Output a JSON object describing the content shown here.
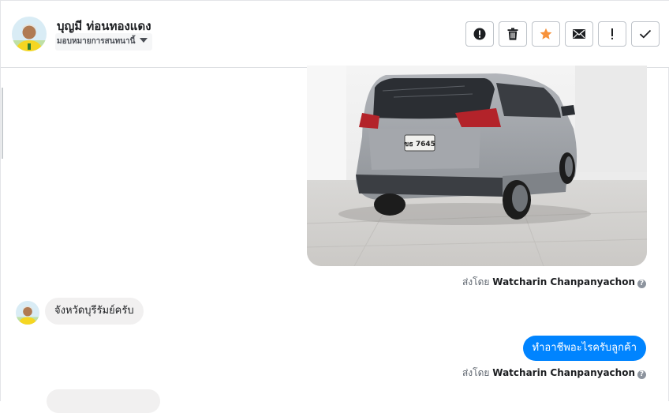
{
  "header": {
    "contact_name": "บุญมี ท่อนทองแดง",
    "assign_label": "มอบหมายการสนทนานี้",
    "actions": [
      {
        "name": "report-spam",
        "icon": "alert-circle-icon"
      },
      {
        "name": "delete",
        "icon": "trash-icon"
      },
      {
        "name": "star",
        "icon": "star-icon"
      },
      {
        "name": "mark-unread",
        "icon": "envelope-icon"
      },
      {
        "name": "follow-up",
        "icon": "exclamation-icon"
      },
      {
        "name": "mark-done",
        "icon": "checkmark-icon"
      }
    ]
  },
  "messages": {
    "image_message": {
      "plate_text": "ขธ 7645",
      "sent_by_prefix": "ส่งโดย",
      "sent_by_name": "Watcharin Chanpanyachon",
      "help_glyph": "?"
    },
    "incoming_text": "จังหวัดบุรีรัมย์ครับ",
    "outgoing_text": "ทำอาชีพอะไรครับลูกค้า",
    "outgoing_sent_by_prefix": "ส่งโดย",
    "outgoing_sent_by_name": "Watcharin Chanpanyachon",
    "outgoing_help_glyph": "?"
  },
  "colors": {
    "accent_blue": "#0084ff",
    "star_orange": "#f7923b",
    "incoming_bubble": "#f1f0f0"
  }
}
